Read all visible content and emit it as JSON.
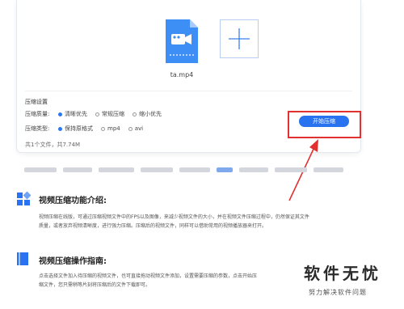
{
  "card": {
    "file_name": "ta.mp4",
    "settings_title": "压缩设置",
    "quality": {
      "label": "压缩质量:",
      "options": [
        "清晰优先",
        "常规压缩",
        "缩小优先"
      ],
      "selected": "清晰优先"
    },
    "type": {
      "label": "压缩类型:",
      "options": [
        "保持原格式",
        "mp4",
        "avi"
      ],
      "selected": "保持原格式"
    },
    "start_button": "开始压缩",
    "file_count": "共1个文件，共7.74M"
  },
  "sections": [
    {
      "title": "视频压缩功能介绍:",
      "body": [
        "视频压缩在线版，可通过压缩视频文件中的FPS以及图像，来减少视频文件的大小，并在视频文件压缩过程中，仍然保证其文件",
        "质量，或者放弃视频清晰度，进行强力压缩。压缩后的视频文件，同样可以借助常用的视频播放器来打开。"
      ]
    },
    {
      "title": "视频压缩操作指南:",
      "body": [
        "点击选择文件加入待压缩的视频文件，也可直接拖动视频文件添加，设置需要压缩的参数，点击开始压",
        "缩文件，您只需稍等片刻将压缩后的文件下载即可。"
      ]
    }
  ],
  "watermark": {
    "main": "软件无忧",
    "sub": "努力解决软件问题"
  },
  "colors": {
    "accent": "#2a73f0",
    "highlight_box": "#e23131"
  }
}
